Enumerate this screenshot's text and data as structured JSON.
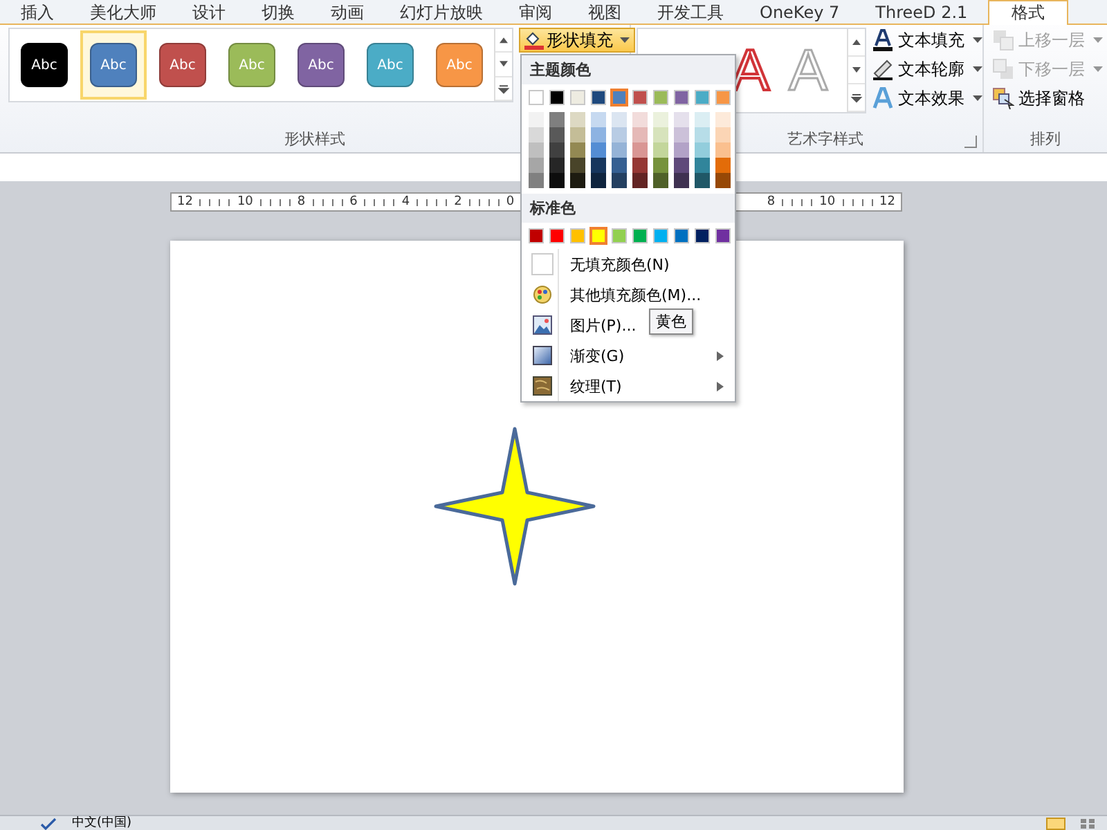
{
  "tabs": [
    {
      "label": "插入",
      "selected": false
    },
    {
      "label": "美化大师",
      "selected": false
    },
    {
      "label": "设计",
      "selected": false
    },
    {
      "label": "切换",
      "selected": false
    },
    {
      "label": "动画",
      "selected": false
    },
    {
      "label": "幻灯片放映",
      "selected": false
    },
    {
      "label": "审阅",
      "selected": false
    },
    {
      "label": "视图",
      "selected": false
    },
    {
      "label": "开发工具",
      "selected": false
    },
    {
      "label": "OneKey 7",
      "selected": false
    },
    {
      "label": "ThreeD 2.1",
      "selected": false
    },
    {
      "label": "格式",
      "selected": true
    }
  ],
  "shape_styles": {
    "group_label": "形状样式",
    "swatches": [
      {
        "label": "Abc",
        "color": "#000000",
        "selected": false
      },
      {
        "label": "Abc",
        "color": "#4f81bd",
        "selected": true
      },
      {
        "label": "Abc",
        "color": "#c0504d",
        "selected": false
      },
      {
        "label": "Abc",
        "color": "#9bbb59",
        "selected": false
      },
      {
        "label": "Abc",
        "color": "#8064a2",
        "selected": false
      },
      {
        "label": "Abc",
        "color": "#4bacc6",
        "selected": false
      },
      {
        "label": "Abc",
        "color": "#f79646",
        "selected": false
      }
    ],
    "fill_button": {
      "label": "形状填充",
      "expanded": true
    }
  },
  "wordart": {
    "group_label": "艺术字样式",
    "styles": [
      {
        "kind": "red-outline",
        "label": "A"
      },
      {
        "kind": "gray-outline",
        "label": "A"
      }
    ],
    "buttons": [
      {
        "kind": "fill",
        "label": "文本填充"
      },
      {
        "kind": "outline",
        "label": "文本轮廓"
      },
      {
        "kind": "effect",
        "label": "文本效果"
      }
    ]
  },
  "arrange": {
    "group_label": "排列",
    "buttons": [
      {
        "kind": "forward",
        "label": "上移一层",
        "disabled": true
      },
      {
        "kind": "backward",
        "label": "下移一层",
        "disabled": true
      },
      {
        "kind": "pane",
        "label": "选择窗格",
        "disabled": false
      }
    ]
  },
  "fill_menu": {
    "theme_heading": "主题颜色",
    "theme_colors": [
      {
        "color": "#ffffff",
        "selected": false,
        "shades": [
          {
            "color": "#f2f2f2"
          },
          {
            "color": "#d9d9d9"
          },
          {
            "color": "#bfbfbf"
          },
          {
            "color": "#a6a6a6"
          },
          {
            "color": "#808080"
          }
        ]
      },
      {
        "color": "#000000",
        "selected": false,
        "shades": [
          {
            "color": "#7f7f7f"
          },
          {
            "color": "#595959"
          },
          {
            "color": "#404040"
          },
          {
            "color": "#262626"
          },
          {
            "color": "#0d0d0d"
          }
        ]
      },
      {
        "color": "#eeece1",
        "selected": false,
        "shades": [
          {
            "color": "#ddd9c3"
          },
          {
            "color": "#c4bd97"
          },
          {
            "color": "#938953"
          },
          {
            "color": "#494429"
          },
          {
            "color": "#1d1b10"
          }
        ]
      },
      {
        "color": "#1f497d",
        "selected": false,
        "shades": [
          {
            "color": "#c6d9f0"
          },
          {
            "color": "#8db3e2"
          },
          {
            "color": "#548dd4"
          },
          {
            "color": "#17365d"
          },
          {
            "color": "#0f243e"
          }
        ]
      },
      {
        "color": "#4f81bd",
        "selected": true,
        "shades": [
          {
            "color": "#dbe5f1"
          },
          {
            "color": "#b8cce4"
          },
          {
            "color": "#95b3d7"
          },
          {
            "color": "#366092"
          },
          {
            "color": "#244061"
          }
        ]
      },
      {
        "color": "#c0504d",
        "selected": false,
        "shades": [
          {
            "color": "#f2dcdb"
          },
          {
            "color": "#e5b9b7"
          },
          {
            "color": "#d99694"
          },
          {
            "color": "#953734"
          },
          {
            "color": "#632423"
          }
        ]
      },
      {
        "color": "#9bbb59",
        "selected": false,
        "shades": [
          {
            "color": "#ebf1dd"
          },
          {
            "color": "#d7e3bc"
          },
          {
            "color": "#c3d69b"
          },
          {
            "color": "#76923c"
          },
          {
            "color": "#4f6128"
          }
        ]
      },
      {
        "color": "#8064a2",
        "selected": false,
        "shades": [
          {
            "color": "#e5e0ec"
          },
          {
            "color": "#ccc1d9"
          },
          {
            "color": "#b2a2c7"
          },
          {
            "color": "#5f497a"
          },
          {
            "color": "#3f3151"
          }
        ]
      },
      {
        "color": "#4bacc6",
        "selected": false,
        "shades": [
          {
            "color": "#dbeef3"
          },
          {
            "color": "#b7dde8"
          },
          {
            "color": "#92cddc"
          },
          {
            "color": "#31859b"
          },
          {
            "color": "#205867"
          }
        ]
      },
      {
        "color": "#f79646",
        "selected": false,
        "shades": [
          {
            "color": "#fdeada"
          },
          {
            "color": "#fbd5b5"
          },
          {
            "color": "#fac08f"
          },
          {
            "color": "#e36c09"
          },
          {
            "color": "#974806"
          }
        ]
      }
    ],
    "standard_heading": "标准色",
    "standard_colors": [
      {
        "color": "#c00000",
        "selected": false
      },
      {
        "color": "#ff0000",
        "selected": false
      },
      {
        "color": "#ffc000",
        "selected": false
      },
      {
        "color": "#ffff00",
        "selected": true
      },
      {
        "color": "#92d050",
        "selected": false
      },
      {
        "color": "#00b050",
        "selected": false
      },
      {
        "color": "#00b0f0",
        "selected": false
      },
      {
        "color": "#0070c0",
        "selected": false
      },
      {
        "color": "#002060",
        "selected": false
      },
      {
        "color": "#7030a0",
        "selected": false
      }
    ],
    "items": [
      {
        "kind": "none",
        "label": "无填充颜色(N)",
        "submenu": false
      },
      {
        "kind": "more",
        "label": "其他填充颜色(M)...",
        "submenu": false
      },
      {
        "kind": "picture",
        "label": "图片(P)...",
        "submenu": false
      },
      {
        "kind": "gradient",
        "label": "渐变(G)",
        "submenu": true
      },
      {
        "kind": "texture",
        "label": "纹理(T)",
        "submenu": true
      }
    ],
    "tooltip": "黄色"
  },
  "ruler": {
    "left_labels": [
      "12",
      "10",
      "8",
      "6",
      "4",
      "2",
      "0"
    ],
    "right_labels": [
      "8",
      "10",
      "12"
    ]
  },
  "slide": {
    "shape": {
      "kind": "star4"
    }
  },
  "status_bar": {
    "language": "中文(中国)"
  }
}
